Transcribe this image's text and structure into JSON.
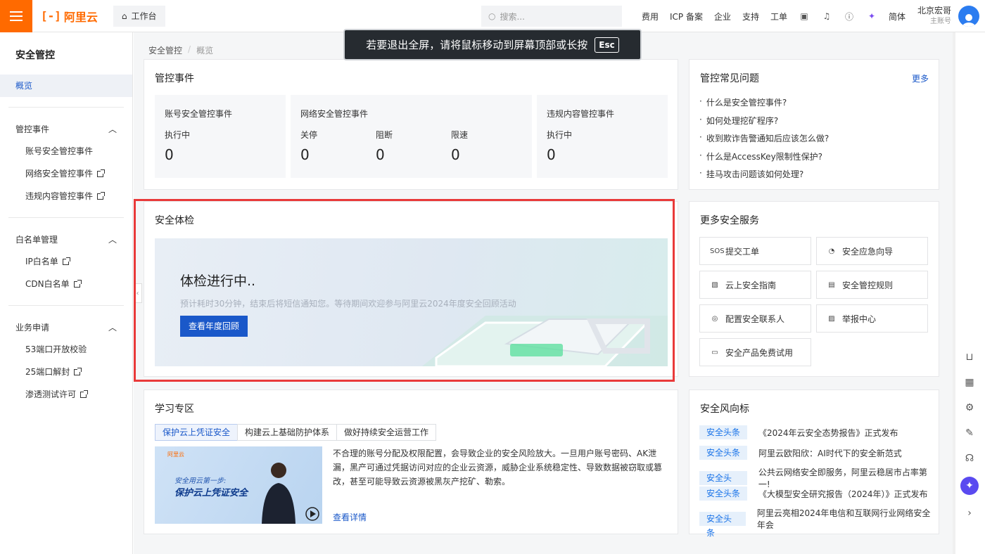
{
  "header": {
    "logo_text": "阿里云",
    "workbench": "工作台",
    "search_placeholder": "搜索...",
    "links": [
      "费用",
      "ICP 备案",
      "企业",
      "支持",
      "工单"
    ],
    "lang": "简体",
    "account_name": "北京宏哥",
    "account_role": "主账号"
  },
  "toast": {
    "text": "若要退出全屏，请将鼠标移动到屏幕顶部或长按",
    "key": "Esc"
  },
  "sidebar": {
    "title": "安全管控",
    "active": "概览",
    "groups": [
      {
        "label": "管控事件",
        "items": [
          "账号安全管控事件",
          "网络安全管控事件",
          "违规内容管控事件"
        ]
      },
      {
        "label": "白名单管理",
        "items": [
          "IP白名单",
          "CDN白名单"
        ]
      },
      {
        "label": "业务申请",
        "items": [
          "53端口开放校验",
          "25端口解封",
          "渗透测试许可"
        ]
      }
    ]
  },
  "breadcrumb": [
    "安全管控",
    "概览"
  ],
  "events": {
    "title": "管控事件",
    "account": {
      "title": "账号安全管控事件",
      "label": "执行中",
      "value": "0"
    },
    "network": {
      "title": "网络安全管控事件",
      "cols": [
        {
          "label": "关停",
          "value": "0"
        },
        {
          "label": "阻断",
          "value": "0"
        },
        {
          "label": "限速",
          "value": "0"
        }
      ]
    },
    "content": {
      "title": "违规内容管控事件",
      "label": "执行中",
      "value": "0"
    }
  },
  "faq": {
    "title": "管控常见问题",
    "more": "更多",
    "items": [
      "什么是安全管控事件?",
      "如何处理挖矿程序?",
      "收到欺诈告警通知后应该怎么做?",
      "什么是AccessKey限制性保护?",
      "挂马攻击问题该如何处理?"
    ]
  },
  "checkup": {
    "title": "安全体检",
    "heading": "体检进行中..",
    "desc": "预计耗时30分钟，结束后将短信通知您。等待期间欢迎参与阿里云2024年度安全回顾活动",
    "button": "查看年度回顾"
  },
  "services": {
    "title": "更多安全服务",
    "items": [
      {
        "label": "提交工单",
        "icon": "SOS"
      },
      {
        "label": "安全应急向导",
        "icon": "emergency-icon"
      },
      {
        "label": "云上安全指南",
        "icon": "guide-icon"
      },
      {
        "label": "安全管控规则",
        "icon": "document-icon"
      },
      {
        "label": "配置安全联系人",
        "icon": "contact-icon"
      },
      {
        "label": "举报中心",
        "icon": "report-icon"
      },
      {
        "label": "安全产品免费试用",
        "icon": "trial-icon"
      }
    ]
  },
  "learning": {
    "title": "学习专区",
    "tabs": [
      "保护云上凭证安全",
      "构建云上基础防护体系",
      "做好持续安全运营工作"
    ],
    "video_logo": "阿里云",
    "video_line1": "安全用云第一步:",
    "video_line2": "保护云上凭证安全",
    "text": "不合理的账号分配及权限配置，会导致企业的安全风险放大。一旦用户账号密码、AK泄漏，黑产可通过凭据访问对应的企业云资源，威胁企业系统稳定性、导致数据被窃取或篡改，甚至可能导致云资源被黑灰产挖矿、勒索。",
    "link": "查看详情"
  },
  "news": {
    "title": "安全风向标",
    "items": [
      {
        "badge": "安全头条",
        "text": "《2024年云安全态势报告》正式发布"
      },
      {
        "badge": "安全头条",
        "text": "阿里云欧阳欣：AI时代下的安全新范式"
      },
      {
        "badge": "安全头条",
        "text": "公共云网络安全即服务，阿里云稳居市占率第一!"
      },
      {
        "badge": "安全头条",
        "text": "《大模型安全研究报告（2024年）》正式发布"
      },
      {
        "badge": "安全头条",
        "text": "阿里云亮相2024年电信和互联网行业网络安全年会"
      }
    ]
  },
  "colors": {
    "brand": "#ff6a00",
    "link": "#1a58c9",
    "highlight": "#e93a3a"
  }
}
